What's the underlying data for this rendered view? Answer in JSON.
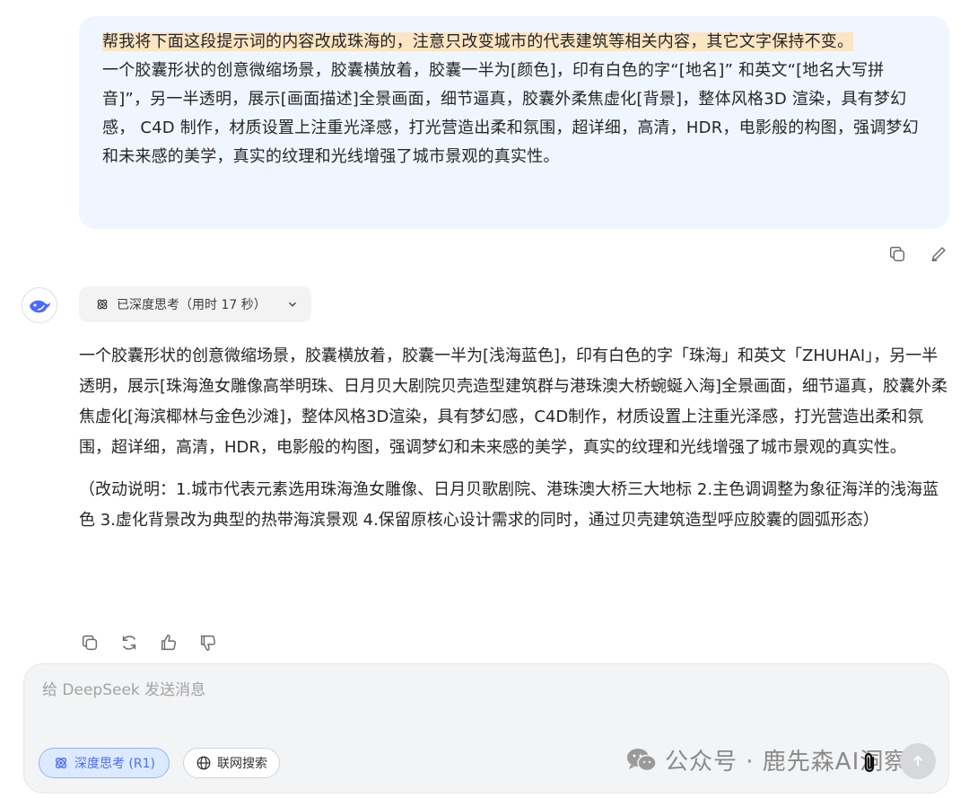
{
  "user_message": {
    "highlight": "帮我将下面这段提示词的内容改成珠海的，注意只改变城市的代表建筑等相关内容，其它文字保持不变。",
    "body": "一个胶囊形状的创意微缩场景，胶囊横放着，胶囊一半为[颜色]，印有白色的字“[地名]” 和英文“[地名大写拼音]”，另一半透明，展示[画面描述]全景画面，细节逼真，胶囊外柔焦虚化[背景]，整体风格3D 渲染，具有梦幻感， C4D 制作，材质设置上注重光泽感，打光营造出柔和氛围，超详细，高清，HDR，电影般的构图，强调梦幻和未来感的美学，真实的纹理和光线增强了城市景观的真实性。"
  },
  "user_actions": {
    "copy_icon": "copy-icon",
    "edit_icon": "edit-icon"
  },
  "assistant": {
    "avatar_icon": "deepseek-whale-icon",
    "thinking_chip": "已深度思考（用时 17 秒）",
    "answer_p1": "一个胶囊形状的创意微缩场景，胶囊横放着，胶囊一半为[浅海蓝色]，印有白色的字「珠海」和英文「ZHUHAI」，另一半透明，展示[珠海渔女雕像高举明珠、日月贝大剧院贝壳造型建筑群与港珠澳大桥蜿蜒入海]全景画面，细节逼真，胶囊外柔焦虚化[海滨椰林与金色沙滩]，整体风格3D渲染，具有梦幻感，C4D制作，材质设置上注重光泽感，打光营造出柔和氛围，超详细，高清，HDR，电影般的构图，强调梦幻和未来感的美学，真实的纹理和光线增强了城市景观的真实性。",
    "answer_p2": "（改动说明：1.城市代表元素选用珠海渔女雕像、日月贝歌剧院、港珠澳大桥三大地标 2.主色调调整为象征海洋的浅海蓝色 3.虚化背景改为典型的热带海滨景观 4.保留原核心设计需求的同时，通过贝壳建筑造型呼应胶囊的圆弧形态）"
  },
  "composer": {
    "placeholder": "给 DeepSeek 发送消息",
    "deep_think_label": "深度思考 (R1)",
    "search_label": "联网搜索",
    "watermark": "公众号 · 鹿先森AI洞察"
  },
  "colors": {
    "accent": "#4d6bfe",
    "user_bubble": "#eff6ff",
    "highlight": "#fbe5c3"
  }
}
